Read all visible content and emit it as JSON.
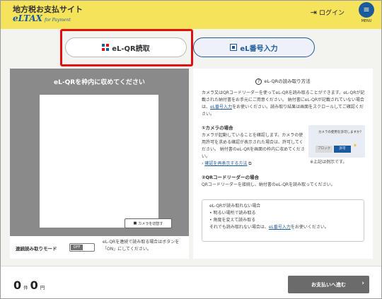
{
  "header": {
    "site_title": "地方税お支払サイト",
    "logo_main": "eLTAX",
    "logo_sub": "for Payment",
    "login_label": "ログイン",
    "menu_label": "MENU"
  },
  "tabs": {
    "qr_label": "eL-QR読取",
    "number_label": "eL番号入力",
    "active": "qr"
  },
  "camera": {
    "title": "eL-QRを枠内に収めてください",
    "switch_label": "カメラを切替す"
  },
  "continuous": {
    "label": "連続読み取りモード",
    "toggle_state": "OFF",
    "description": "eL-QRを連続で読み取る場合はボタンを「ON」にしてください。"
  },
  "instructions": {
    "title": "eL-QRの読み取り方法",
    "intro_text": "カメラ又はQRコードリーダーを使ってeL-QRを読み取ることができます。eL-QRが記載された納付書をお手元にご用意ください。 納付書にeL-QRが記載されていない場合は、",
    "intro_link": "eL番号入力",
    "intro_text2": "をお使いください。読み取り結果は画面をスクロールしてご確認ください。",
    "camera_heading": "①カメラの場合",
    "camera_text": "カメラが起動していることを確認します。カメラの使用許可を求める確認が表示された場合は、許可してください。 納付書のeL-QRを画面の枠内に収めてください。",
    "camera_link": "確認を再表示する方法",
    "permit_msg": "カメラの使用を許可しますか？",
    "permit_block": "ブロック",
    "permit_allow": "許可",
    "example_note": "※上記は例示です。",
    "reader_heading": "②QRコードリーダーの場合",
    "reader_text": "QRコードリーダーを接続し、納付書のeL-QRを読み取ってください。",
    "note_title": "eL-QRが読み取れない場合",
    "note_items": [
      "明るい場所で読み取る",
      "角度を変えて読み取る"
    ],
    "note_text": "それでも読み取れない場合は、",
    "note_link": "eL番号入力",
    "note_text2": "をお使いください。"
  },
  "footer": {
    "count_value": "0",
    "count_unit": "件",
    "amount_value": "0",
    "amount_unit": "円",
    "pay_button": "お支払いへ進む"
  },
  "colors": {
    "header_bg": "#f6e35c",
    "brand_blue": "#1c5a9e",
    "highlight_red": "#e01010",
    "camera_bg": "#8a8a8a",
    "pay_button_bg": "#6b6b6b"
  }
}
